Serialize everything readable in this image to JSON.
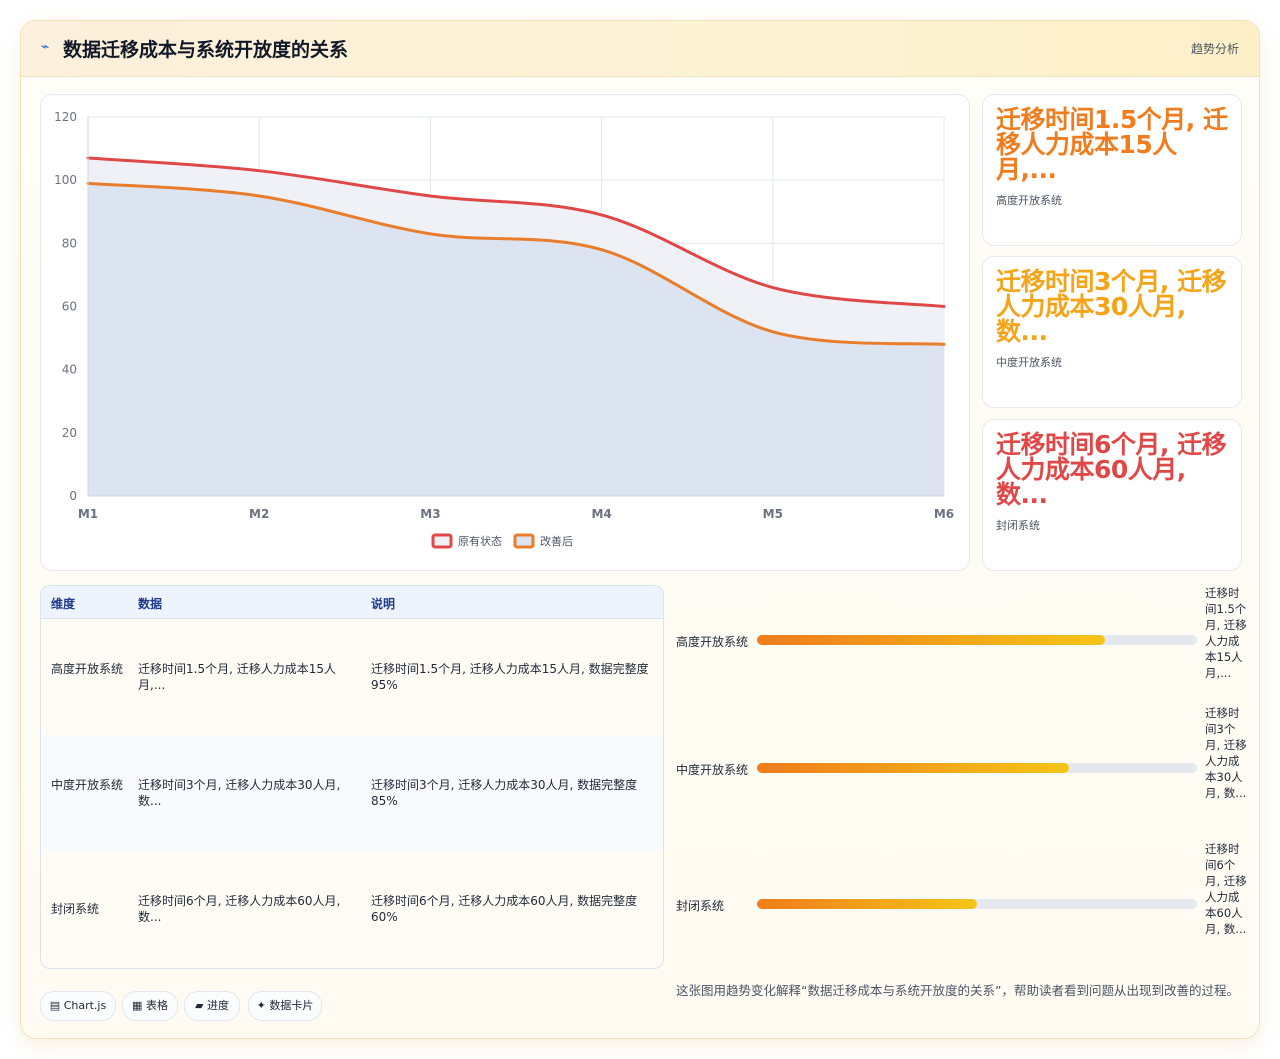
{
  "header": {
    "icon": "trend-icon",
    "title": "数据迁移成本与系统开放度的关系",
    "tag": "趋势分析"
  },
  "chart_data": {
    "type": "line",
    "categories": [
      "M1",
      "M2",
      "M3",
      "M4",
      "M5",
      "M6"
    ],
    "series": [
      {
        "name": "原有状态",
        "values": [
          107,
          103,
          95,
          89,
          66,
          60
        ],
        "color": "#e04848",
        "fill": "#eef0f6"
      },
      {
        "name": "改善后",
        "values": [
          99,
          95,
          83,
          78,
          52,
          48
        ],
        "color": "#ea7d2b",
        "fill": "#dbe3f0"
      }
    ],
    "ylim": [
      0,
      120
    ],
    "yticks": [
      0,
      20,
      40,
      60,
      80,
      100,
      120
    ],
    "grid": true,
    "legend_position": "bottom-center",
    "smooth": true
  },
  "stats": [
    {
      "value": "迁移时间1.5个月, 迁移人力成本15人月,...",
      "label": "高度开放系统",
      "color": "#f07c1e"
    },
    {
      "value": "迁移时间3个月, 迁移人力成本30人月, 数...",
      "label": "中度开放系统",
      "color": "#f5a41a"
    },
    {
      "value": "迁移时间6个月, 迁移人力成本60人月, 数...",
      "label": "封闭系统",
      "color": "#e04848"
    }
  ],
  "table": {
    "headers": [
      "维度",
      "数据",
      "说明"
    ],
    "rows": [
      [
        "高度开放系统",
        "迁移时间1.5个月, 迁移人力成本15人月,...",
        "迁移时间1.5个月, 迁移人力成本15人月, 数据完整度95%"
      ],
      [
        "中度开放系统",
        "迁移时间3个月, 迁移人力成本30人月, 数...",
        "迁移时间3个月, 迁移人力成本30人月, 数据完整度85%"
      ],
      [
        "封闭系统",
        "迁移时间6个月, 迁移人力成本60人月, 数...",
        "迁移时间6个月, 迁移人力成本60人月, 数据完整度60%"
      ]
    ]
  },
  "progress": [
    {
      "label": "高度开放系统",
      "value": 0.79,
      "note": "迁移时间1.5个月, 迁移人力成本15人月,..."
    },
    {
      "label": "中度开放系统",
      "value": 0.71,
      "note": "迁移时间3个月, 迁移人力成本30人月, 数..."
    },
    {
      "label": "封闭系统",
      "value": 0.5,
      "note": "迁移时间6个月, 迁移人力成本60人月, 数..."
    }
  ],
  "chips": [
    {
      "icon": "▤",
      "label": "Chart.js"
    },
    {
      "icon": "▦",
      "label": "表格"
    },
    {
      "icon": "▰",
      "label": "进度"
    },
    {
      "icon": "✦",
      "label": "数据卡片"
    }
  ],
  "caption": "这张图用趋势变化解释“数据迁移成本与系统开放度的关系”，帮助读者看到问题从出现到改善的过程。"
}
